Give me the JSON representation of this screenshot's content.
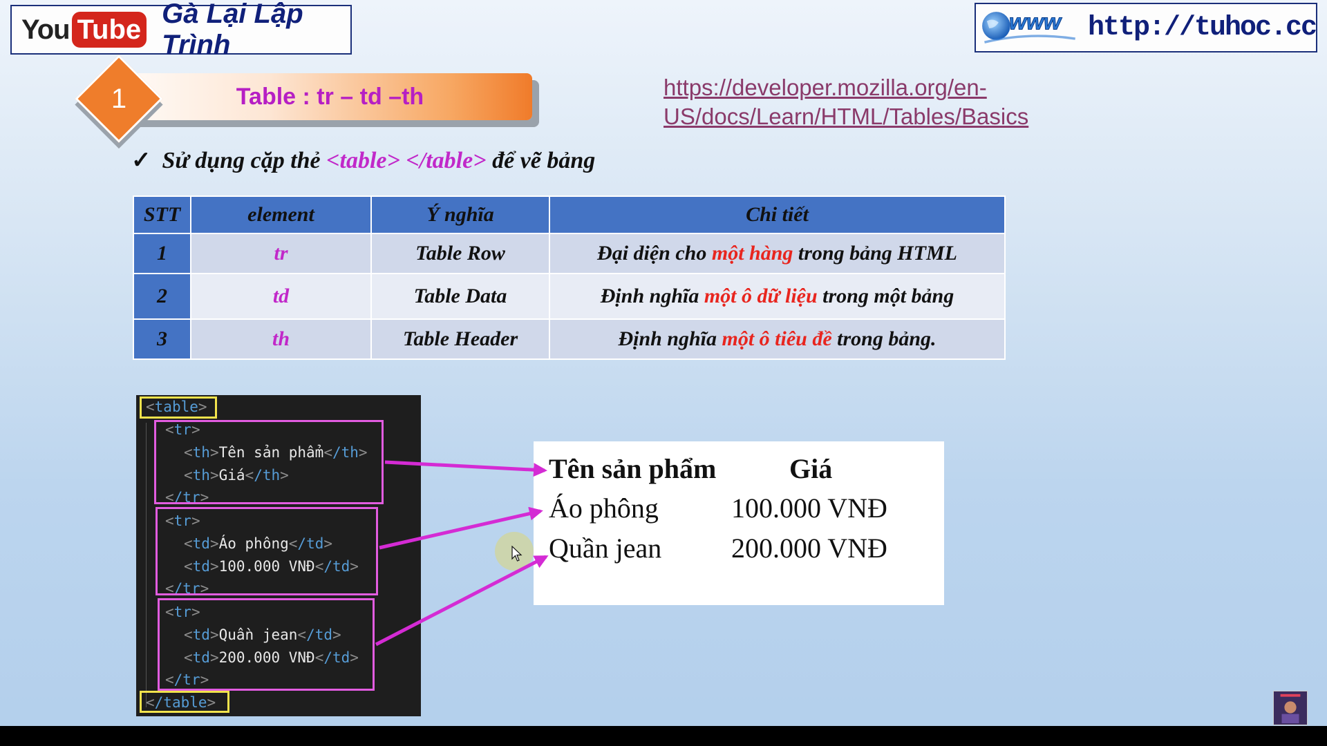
{
  "header": {
    "youtube_you": "You",
    "youtube_tube": "Tube",
    "channel_name": "Gà Lại Lập Trình",
    "site_logo_text": "www",
    "site_url": "http://tuhoc.cc"
  },
  "section": {
    "number": "1",
    "title": "Table : tr – td –th"
  },
  "reference_link": {
    "line1": "https://developer.mozilla.org/en-",
    "line2": "US/docs/Learn/HTML/Tables/Basics"
  },
  "bullet": {
    "check": "✓",
    "prefix": "Sử dụng cặp thẻ ",
    "tags": "<table> </table>",
    "suffix": " để vẽ bảng"
  },
  "table": {
    "headers": [
      "STT",
      "element",
      "Ý nghĩa",
      "Chi tiết"
    ],
    "rows": [
      {
        "stt": "1",
        "element": "tr",
        "meaning": "Table Row",
        "detail_pre": "Đại diện cho ",
        "detail_hl": "một hàng",
        "detail_post": " trong bảng HTML"
      },
      {
        "stt": "2",
        "element": "td",
        "meaning": "Table Data",
        "detail_pre": "Định nghĩa ",
        "detail_hl": "một ô dữ liệu",
        "detail_post": " trong một bảng"
      },
      {
        "stt": "3",
        "element": "th",
        "meaning": "Table Header",
        "detail_pre": "Định nghĩa ",
        "detail_hl": "một ô tiêu đề",
        "detail_post": " trong bảng."
      }
    ]
  },
  "code": {
    "table_open": "table",
    "table_close": "/table",
    "tr_open": "tr",
    "tr_close": "/tr",
    "th_tag": "th",
    "th_close": "/th",
    "td_tag": "td",
    "td_close": "/td",
    "cells": {
      "th1": "Tên sản phẩm",
      "th2": "Giá",
      "r1c1": "Áo phông",
      "r1c2": "100.000 VNĐ",
      "r2c1": "Quần jean",
      "r2c2": "200.000 VNĐ"
    }
  },
  "result": {
    "header": [
      "Tên sản phẩm",
      "Giá"
    ],
    "rows": [
      [
        "Áo phông",
        "100.000 VNĐ"
      ],
      [
        "Quần jean",
        "200.000 VNĐ"
      ]
    ]
  },
  "colors": {
    "accent_magenta": "#c128c9",
    "highlight_red": "#e8251e",
    "table_header_blue": "#4473c4",
    "banner_orange": "#ef7d2b",
    "arrow_pink": "#d42bd4"
  },
  "icons": [
    "youtube-logo-icon",
    "www-globe-icon",
    "checkmark-icon",
    "mouse-cursor-icon",
    "channel-avatar-icon"
  ]
}
